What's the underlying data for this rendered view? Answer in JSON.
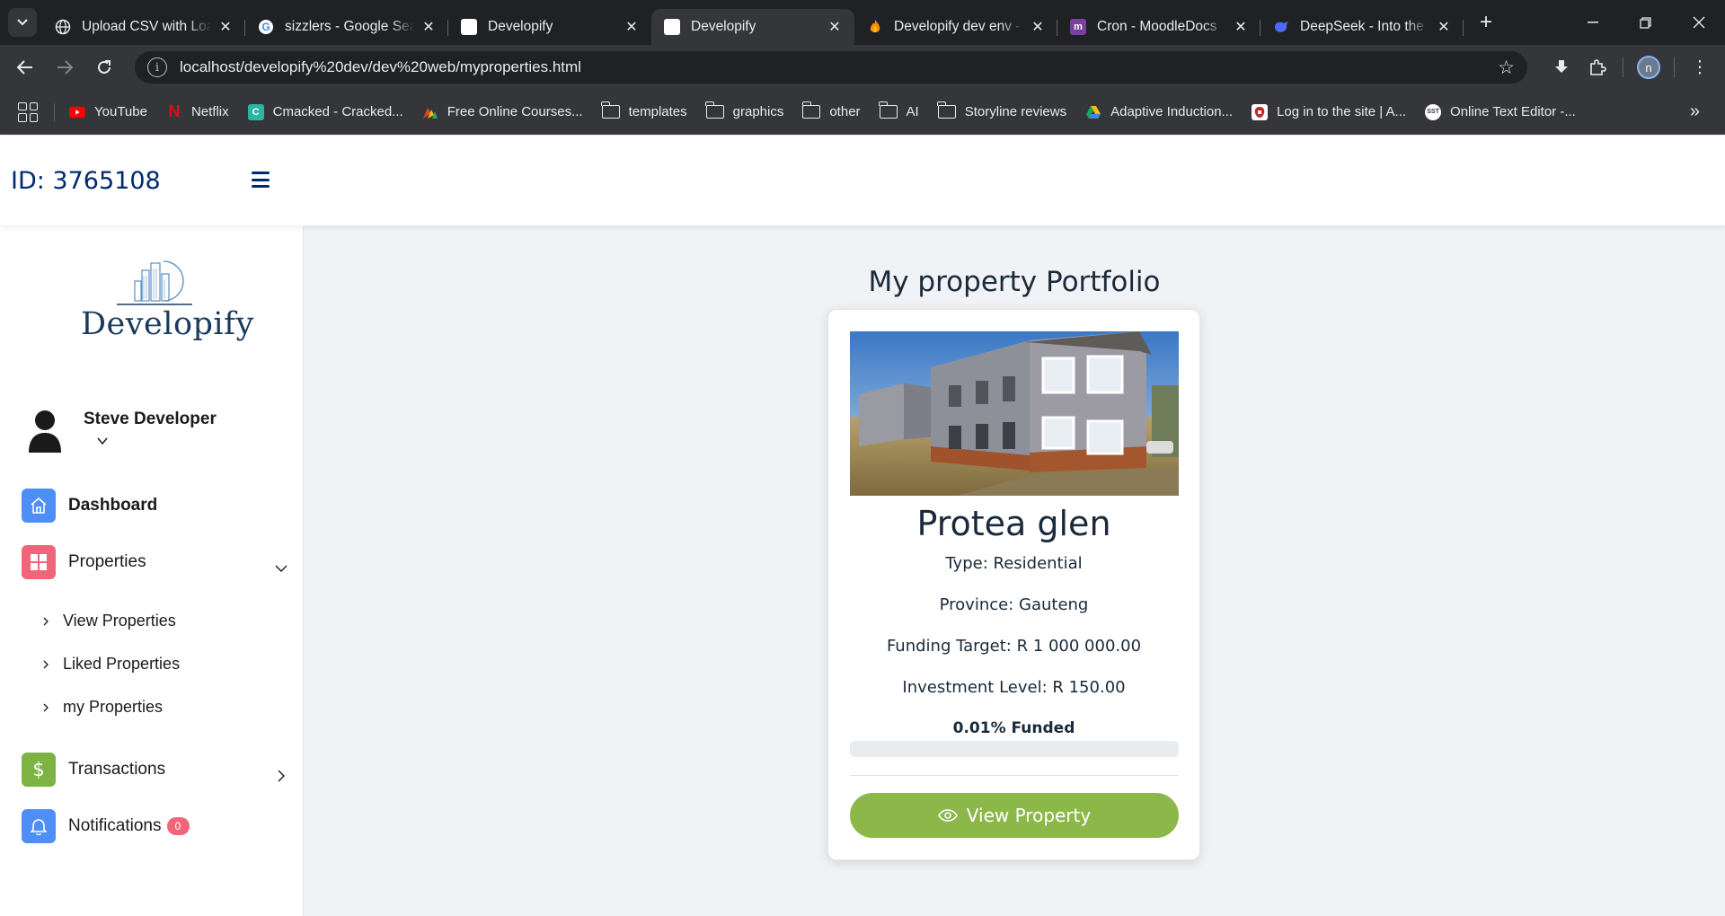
{
  "browser": {
    "tabs": [
      {
        "title": "Upload CSV with Loa",
        "favicon": "globe-icon",
        "active": false
      },
      {
        "title": "sizzlers - Google Sea",
        "favicon": "google-icon",
        "active": false
      },
      {
        "title": "Developify",
        "favicon": "page-icon",
        "active": false
      },
      {
        "title": "Developify",
        "favicon": "page-icon",
        "active": true
      },
      {
        "title": "Developify dev env -",
        "favicon": "firebase-icon",
        "active": false
      },
      {
        "title": "Cron - MoodleDocs",
        "favicon": "moodle-icon",
        "active": false
      },
      {
        "title": "DeepSeek - Into the U",
        "favicon": "deepseek-icon",
        "active": false
      }
    ],
    "url": "localhost/developify%20dev/dev%20web/myproperties.html",
    "profile_initial": "n",
    "bookmarks": [
      {
        "label": "YouTube",
        "icon": "youtube-icon",
        "color": "#ff0000"
      },
      {
        "label": "Netflix",
        "icon": "netflix-icon",
        "color": "#e50914"
      },
      {
        "label": "Cmacked - Cracked...",
        "icon": "cmacked-icon",
        "color": "#2bb5a4"
      },
      {
        "label": "Free Online Courses...",
        "icon": "courses-icon",
        "color": "#f4b400"
      },
      {
        "label": "templates",
        "icon": "folder-icon"
      },
      {
        "label": "graphics",
        "icon": "folder-icon"
      },
      {
        "label": "other",
        "icon": "folder-icon"
      },
      {
        "label": "AI",
        "icon": "folder-icon"
      },
      {
        "label": "Storyline reviews",
        "icon": "folder-icon"
      },
      {
        "label": "Adaptive Induction...",
        "icon": "drive-icon",
        "color": "#1fa463"
      },
      {
        "label": "Log in to the site | A...",
        "icon": "site-icon",
        "color": "#c62828"
      },
      {
        "label": "Online Text Editor -...",
        "icon": "sst-icon",
        "color": "#ffffff"
      }
    ]
  },
  "header": {
    "user_id": "ID: 3765108"
  },
  "sidebar": {
    "logo_text": "Developify",
    "username": "Steve Developer",
    "nav": {
      "dashboard": "Dashboard",
      "properties": "Properties",
      "view_properties": "View Properties",
      "liked_properties": "Liked Properties",
      "my_properties": "my Properties",
      "transactions": "Transactions",
      "notifications": "Notifications",
      "notifications_count": "0"
    },
    "colors": {
      "dashboard": "#4e8ef7",
      "properties": "#f0657a",
      "transactions": "#7cb342",
      "notifications": "#4e8ef7"
    }
  },
  "main": {
    "title": "My property Portfolio",
    "property": {
      "name": "Protea glen",
      "type": "Type: Residential",
      "province": "Province: Gauteng",
      "funding_target": "Funding Target: R 1 000 000.00",
      "investment_level": "Investment Level: R 150.00",
      "funded_label": "0.01% Funded",
      "funded_fraction": 0.0001,
      "button_label": "View Property",
      "button_color": "#8cb84a"
    }
  }
}
